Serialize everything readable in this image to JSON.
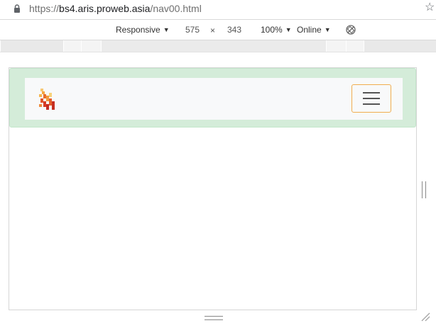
{
  "address_bar": {
    "scheme": "https://",
    "host": "bs4.aris.proweb.asia",
    "path": "/nav00.html",
    "lock_icon": "lock-icon",
    "bookmark_icon": "star-icon"
  },
  "device_toolbar": {
    "device_label": "Responsive",
    "width_value": "575",
    "times_sign": "×",
    "height_value": "343",
    "zoom_label": "100%",
    "network_label": "Online",
    "rotate_icon": "rotate-icon"
  },
  "page": {
    "navbar_background": "#d4ecd9",
    "navbar_inner_background": "#f8f9fa",
    "toggler_border_color": "#f0ad4e",
    "logo_icon": "brand-logo-icon",
    "toggler_icon": "hamburger-icon"
  }
}
